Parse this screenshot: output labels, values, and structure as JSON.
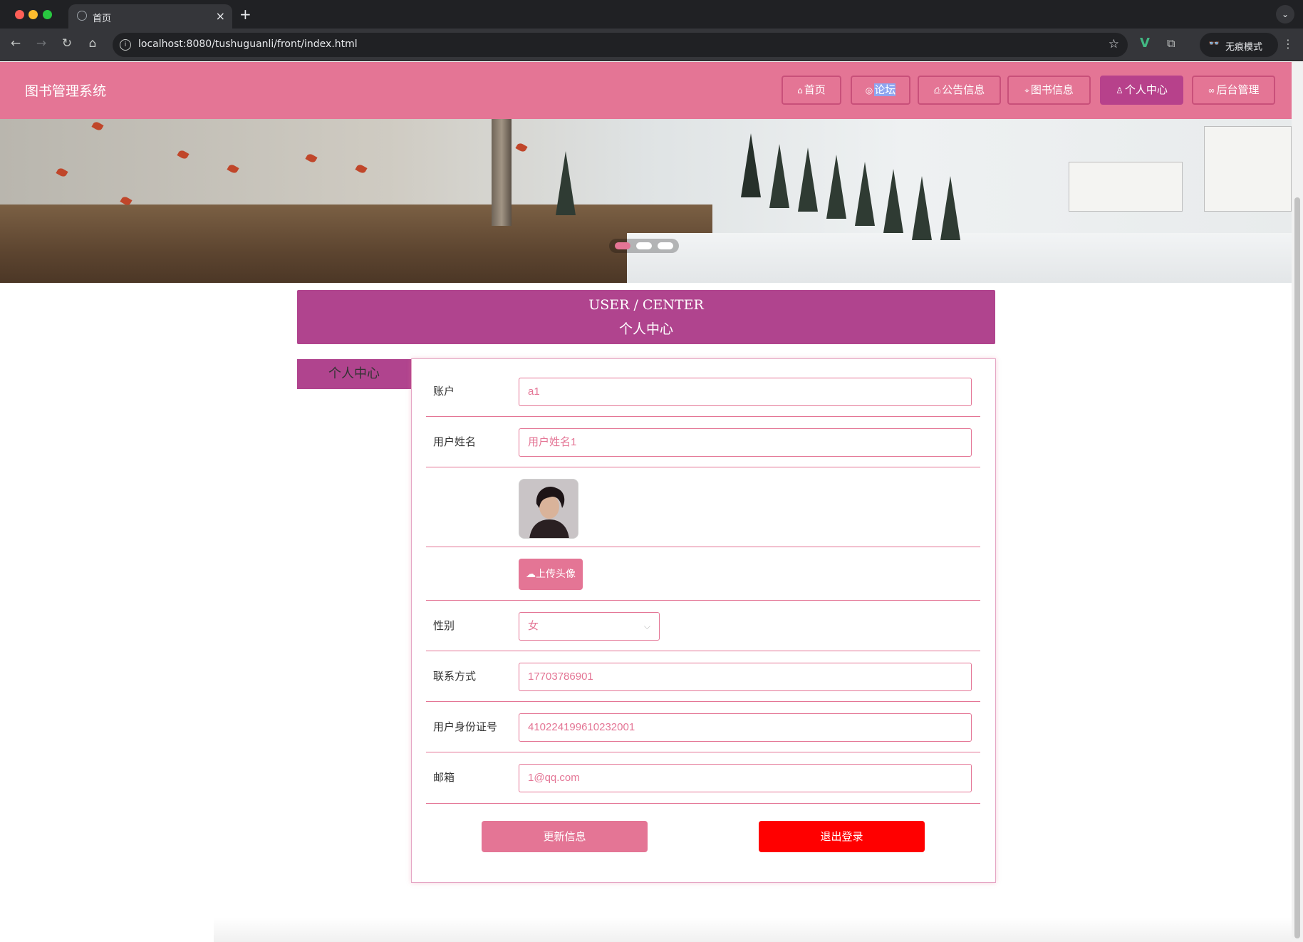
{
  "browser": {
    "tab_title": "首页",
    "url": "localhost:8080/tushuguanli/front/index.html",
    "incognito_label": "无痕模式"
  },
  "site": {
    "title": "图书管理系统",
    "nav": [
      {
        "icon": "home-icon",
        "label": "首页"
      },
      {
        "icon": "globe-icon",
        "label": "论坛"
      },
      {
        "icon": "printer-icon",
        "label": "公告信息"
      },
      {
        "icon": "tag-icon",
        "label": "图书信息"
      },
      {
        "icon": "user-icon",
        "label": "个人中心",
        "active": true
      },
      {
        "icon": "link-icon",
        "label": "后台管理"
      }
    ]
  },
  "banner": {
    "slides": 3,
    "active_slide": 1
  },
  "section": {
    "title_en": "USER / CENTER",
    "title_zh": "个人中心"
  },
  "sidebar": {
    "tab_label": "个人中心"
  },
  "form": {
    "account_label": "账户",
    "account_value": "a1",
    "username_label": "用户姓名",
    "username_value": "用户姓名1",
    "upload_label": "上传头像",
    "gender_label": "性别",
    "gender_value": "女",
    "phone_label": "联系方式",
    "phone_value": "17703786901",
    "idcard_label": "用户身份证号",
    "idcard_value": "410224199610232001",
    "email_label": "邮箱",
    "email_value": "1@qq.com",
    "update_button": "更新信息",
    "logout_button": "退出登录"
  },
  "colors": {
    "brand_pink": "#e47595",
    "section_purple": "#b0448e",
    "logout_red": "#ff0000"
  }
}
